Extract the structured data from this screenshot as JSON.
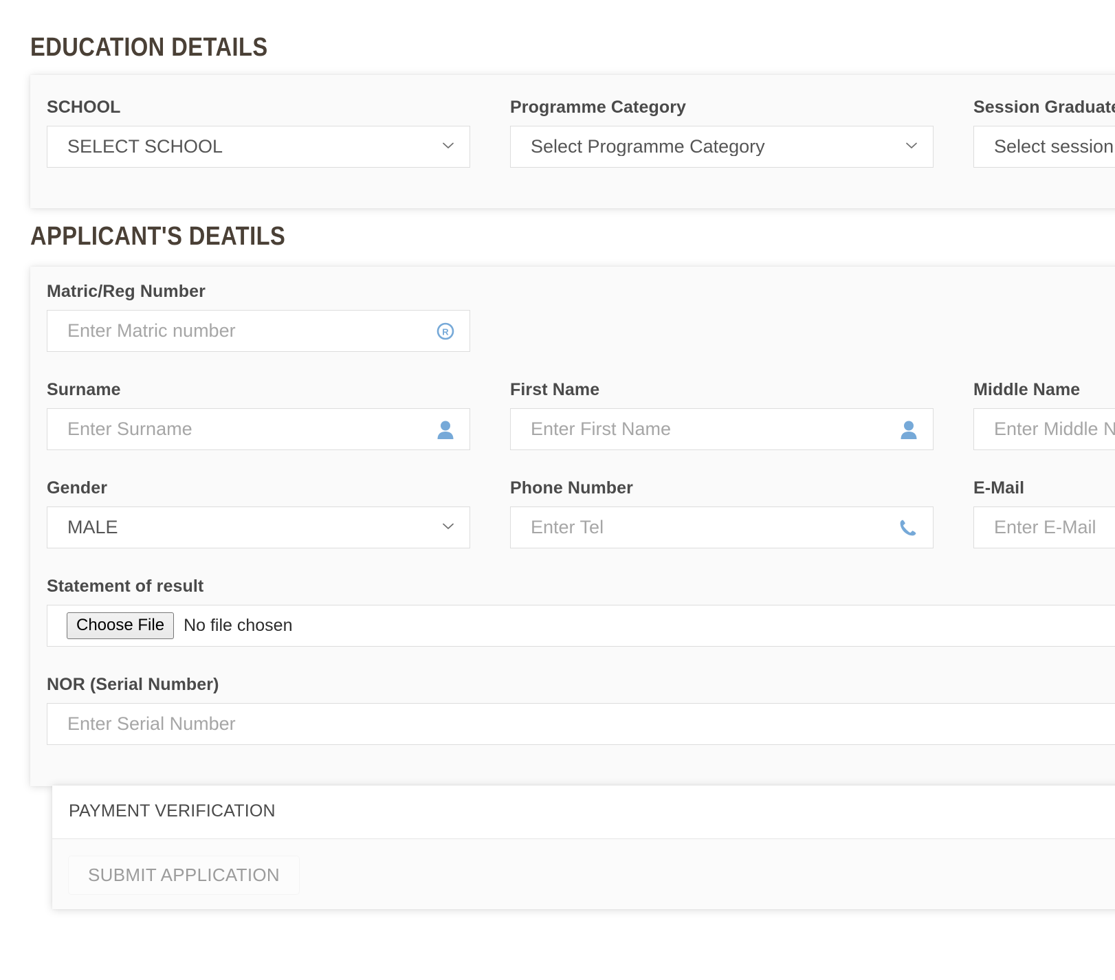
{
  "sections": {
    "education": {
      "heading": "EDUCATION DETAILS",
      "fields": [
        {
          "label": "SCHOOL",
          "value": "SELECT SCHOOL",
          "control": "select",
          "icon": "chevron-down-icon"
        },
        {
          "label": "Programme Category",
          "value": "Select Programme Category",
          "control": "select",
          "icon": "chevron-down-icon"
        },
        {
          "label": "Session Graduated",
          "value": "Select session",
          "control": "select",
          "icon": "chevron-down-icon"
        }
      ]
    },
    "applicant": {
      "heading": "APPLICANT'S DEATILS",
      "matric": {
        "label": "Matric/Reg Number",
        "placeholder": "Enter Matric number",
        "icon": "registered-trademark-icon"
      },
      "surname": {
        "label": "Surname",
        "placeholder": "Enter Surname",
        "icon": "user-icon"
      },
      "first_name": {
        "label": "First Name",
        "placeholder": "Enter First Name",
        "icon": "user-icon"
      },
      "middle_name": {
        "label": "Middle Name",
        "placeholder": "Enter Middle Name",
        "icon": "user-icon"
      },
      "gender": {
        "label": "Gender",
        "value": "MALE",
        "icon": "chevron-down-icon"
      },
      "phone": {
        "label": "Phone Number",
        "placeholder": "Enter Tel",
        "icon": "phone-icon"
      },
      "email": {
        "label": "E-Mail",
        "placeholder": "Enter E-Mail",
        "icon": "envelope-icon"
      },
      "statement_of_result": {
        "label": "Statement of result",
        "button_label": "Choose File",
        "status_text": "No file chosen"
      },
      "nor": {
        "label": "NOR (Serial Number)",
        "placeholder": "Enter Serial Number"
      }
    },
    "payment": {
      "header_title": "PAYMENT VERIFICATION",
      "submit_label": "SUBMIT APPLICATION"
    }
  },
  "colors": {
    "heading": "#4a4036",
    "label": "#4a4a4a",
    "placeholder": "#a6a6a6",
    "icon_blue": "#76a9d8",
    "panel_bg": "#fafafa",
    "page_bg": "#ffffff",
    "border": "#dddddd",
    "submit_text": "#9c9c9c"
  }
}
